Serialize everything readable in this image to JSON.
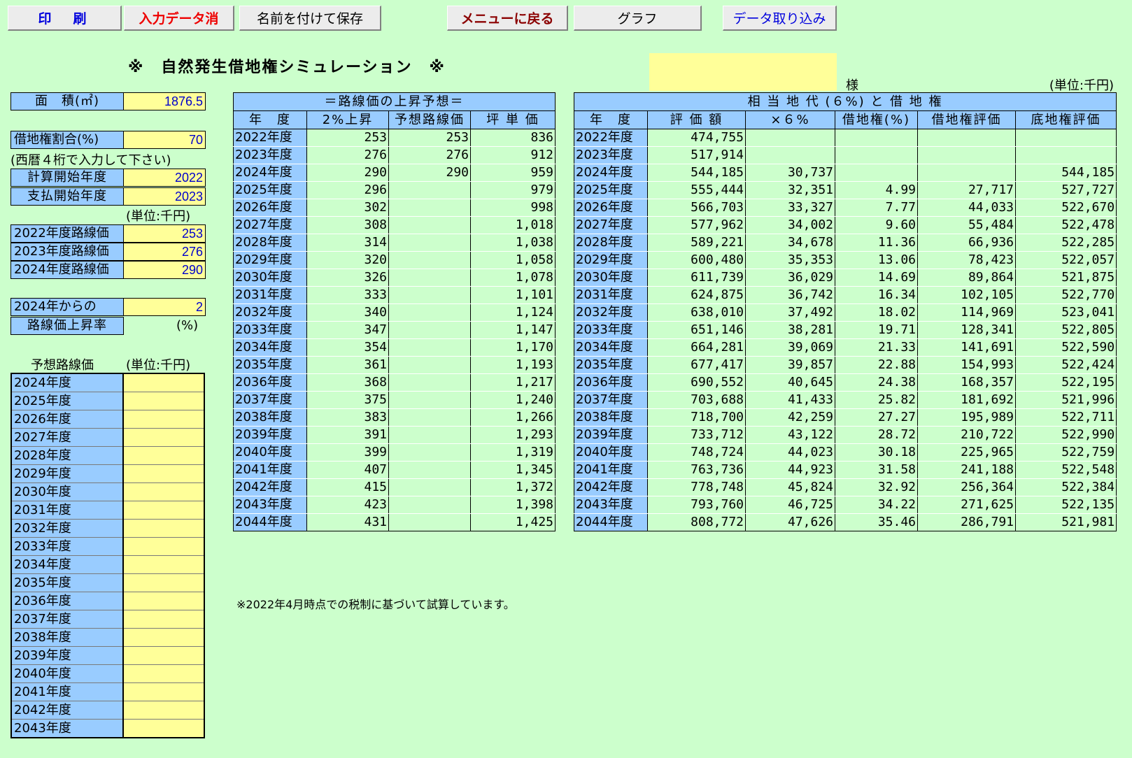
{
  "toolbar": {
    "print_label": "印　刷",
    "clear_label": "入力データ消",
    "save_as_label": "名前を付けて保存",
    "menu_label": "メニューに戻る",
    "graph_label": "グラフ",
    "import_label": "データ取り込み"
  },
  "title": "※　自然発生借地権シミュレーション　※",
  "customer": {
    "name": "",
    "honorific": "様"
  },
  "unit_label": "(単位:千円)",
  "form": {
    "area_label": "面　積(㎡)",
    "area_value": "1876.5",
    "leasehold_ratio_label": "借地権割合(%)",
    "leasehold_ratio_value": "70",
    "year_note": "(西暦４桁で入力して下さい)",
    "calc_start_label": "計算開始年度",
    "calc_start_value": "2022",
    "payment_start_label": "支払開始年度",
    "payment_start_value": "2023",
    "unit_note": "(単位:千円)",
    "road_prices": [
      {
        "label": "2022年度路線価",
        "value": "253"
      },
      {
        "label": "2023年度路線価",
        "value": "276"
      },
      {
        "label": "2024年度路線価",
        "value": "290"
      }
    ],
    "rise_label_1": "2024年からの",
    "rise_label_2": "路線価上昇率",
    "rise_value": "2",
    "rise_unit": "(%)",
    "forecast_label": "予想路線価",
    "forecast_unit": "(単位:千円)",
    "forecast_years": [
      "2024年度",
      "2025年度",
      "2026年度",
      "2027年度",
      "2028年度",
      "2029年度",
      "2030年度",
      "2031年度",
      "2032年度",
      "2033年度",
      "2034年度",
      "2035年度",
      "2036年度",
      "2037年度",
      "2038年度",
      "2039年度",
      "2040年度",
      "2041年度",
      "2042年度",
      "2043年度"
    ]
  },
  "road_table": {
    "title": "＝路線価の上昇予想＝",
    "headers": [
      "年　度",
      "2%上昇",
      "予想路線価",
      "坪 単 価"
    ],
    "rows": [
      [
        "2022年度",
        "253",
        "253",
        "836"
      ],
      [
        "2023年度",
        "276",
        "276",
        "912"
      ],
      [
        "2024年度",
        "290",
        "290",
        "959"
      ],
      [
        "2025年度",
        "296",
        "",
        "979"
      ],
      [
        "2026年度",
        "302",
        "",
        "998"
      ],
      [
        "2027年度",
        "308",
        "",
        "1,018"
      ],
      [
        "2028年度",
        "314",
        "",
        "1,038"
      ],
      [
        "2029年度",
        "320",
        "",
        "1,058"
      ],
      [
        "2030年度",
        "326",
        "",
        "1,078"
      ],
      [
        "2031年度",
        "333",
        "",
        "1,101"
      ],
      [
        "2032年度",
        "340",
        "",
        "1,124"
      ],
      [
        "2033年度",
        "347",
        "",
        "1,147"
      ],
      [
        "2034年度",
        "354",
        "",
        "1,170"
      ],
      [
        "2035年度",
        "361",
        "",
        "1,193"
      ],
      [
        "2036年度",
        "368",
        "",
        "1,217"
      ],
      [
        "2037年度",
        "375",
        "",
        "1,240"
      ],
      [
        "2038年度",
        "383",
        "",
        "1,266"
      ],
      [
        "2039年度",
        "391",
        "",
        "1,293"
      ],
      [
        "2040年度",
        "399",
        "",
        "1,319"
      ],
      [
        "2041年度",
        "407",
        "",
        "1,345"
      ],
      [
        "2042年度",
        "415",
        "",
        "1,372"
      ],
      [
        "2043年度",
        "423",
        "",
        "1,398"
      ],
      [
        "2044年度",
        "431",
        "",
        "1,425"
      ]
    ]
  },
  "lease_table": {
    "title": "相 当 地 代 (６%) と 借 地 権",
    "headers": [
      "年　度",
      "評 価 額",
      "×６%",
      "借地権(%)",
      "借地権評価",
      "底地権評価"
    ],
    "rows": [
      [
        "2022年度",
        "474,755",
        "",
        "",
        "",
        ""
      ],
      [
        "2023年度",
        "517,914",
        "",
        "",
        "",
        ""
      ],
      [
        "2024年度",
        "544,185",
        "30,737",
        "",
        "",
        "544,185"
      ],
      [
        "2025年度",
        "555,444",
        "32,351",
        "4.99",
        "27,717",
        "527,727"
      ],
      [
        "2026年度",
        "566,703",
        "33,327",
        "7.77",
        "44,033",
        "522,670"
      ],
      [
        "2027年度",
        "577,962",
        "34,002",
        "9.60",
        "55,484",
        "522,478"
      ],
      [
        "2028年度",
        "589,221",
        "34,678",
        "11.36",
        "66,936",
        "522,285"
      ],
      [
        "2029年度",
        "600,480",
        "35,353",
        "13.06",
        "78,423",
        "522,057"
      ],
      [
        "2030年度",
        "611,739",
        "36,029",
        "14.69",
        "89,864",
        "521,875"
      ],
      [
        "2031年度",
        "624,875",
        "36,742",
        "16.34",
        "102,105",
        "522,770"
      ],
      [
        "2032年度",
        "638,010",
        "37,492",
        "18.02",
        "114,969",
        "523,041"
      ],
      [
        "2033年度",
        "651,146",
        "38,281",
        "19.71",
        "128,341",
        "522,805"
      ],
      [
        "2034年度",
        "664,281",
        "39,069",
        "21.33",
        "141,691",
        "522,590"
      ],
      [
        "2035年度",
        "677,417",
        "39,857",
        "22.88",
        "154,993",
        "522,424"
      ],
      [
        "2036年度",
        "690,552",
        "40,645",
        "24.38",
        "168,357",
        "522,195"
      ],
      [
        "2037年度",
        "703,688",
        "41,433",
        "25.82",
        "181,692",
        "521,996"
      ],
      [
        "2038年度",
        "718,700",
        "42,259",
        "27.27",
        "195,989",
        "522,711"
      ],
      [
        "2039年度",
        "733,712",
        "43,122",
        "28.72",
        "210,722",
        "522,990"
      ],
      [
        "2040年度",
        "748,724",
        "44,023",
        "30.18",
        "225,965",
        "522,759"
      ],
      [
        "2041年度",
        "763,736",
        "44,923",
        "31.58",
        "241,188",
        "522,548"
      ],
      [
        "2042年度",
        "778,748",
        "45,824",
        "32.92",
        "256,364",
        "522,384"
      ],
      [
        "2043年度",
        "793,760",
        "46,725",
        "34.22",
        "271,625",
        "522,135"
      ],
      [
        "2044年度",
        "808,772",
        "47,626",
        "35.46",
        "286,791",
        "521,981"
      ]
    ]
  },
  "footnote": "※2022年4月時点での税制に基づいて試算しています。"
}
